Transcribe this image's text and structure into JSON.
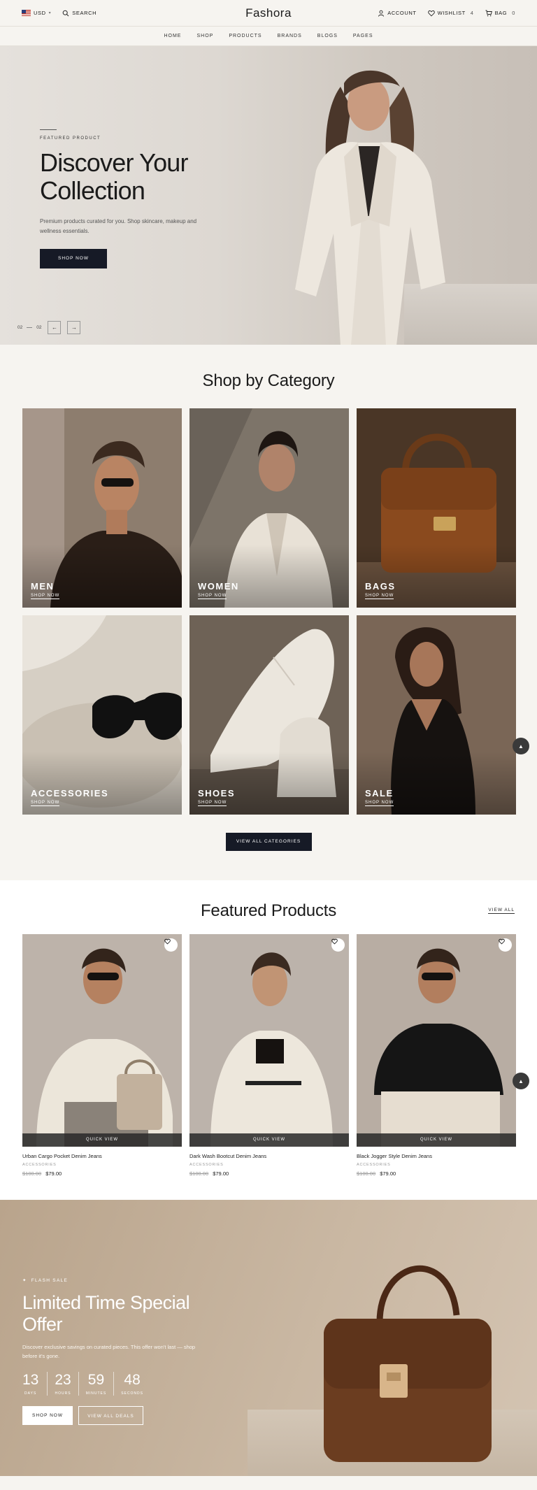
{
  "topbar": {
    "currency": "USD",
    "search_label": "SEARCH",
    "logo": "Fashora",
    "account_label": "ACCOUNT",
    "wishlist_label": "WISHLIST",
    "wishlist_count": "4",
    "bag_label": "BAG",
    "bag_count": "0"
  },
  "nav": {
    "items": [
      "HOME",
      "SHOP",
      "PRODUCTS",
      "BRANDS",
      "BLOGS",
      "PAGES"
    ]
  },
  "hero": {
    "eyebrow": "FEATURED PRODUCT",
    "title_line1": "Discover Your",
    "title_line2": "Collection",
    "subtitle": "Premium products curated for you. Shop skincare, makeup and wellness essentials.",
    "button": "SHOP NOW",
    "pager_current": "02",
    "pager_total": "02"
  },
  "categories": {
    "title": "Shop by Category",
    "items": [
      {
        "label": "MEN",
        "link": "SHOP NOW"
      },
      {
        "label": "WOMEN",
        "link": "SHOP NOW"
      },
      {
        "label": "BAGS",
        "link": "SHOP NOW"
      },
      {
        "label": "ACCESSORIES",
        "link": "SHOP NOW"
      },
      {
        "label": "SHOES",
        "link": "SHOP NOW"
      },
      {
        "label": "SALE",
        "link": "SHOP NOW"
      }
    ],
    "button": "VIEW ALL CATEGORIES"
  },
  "featured": {
    "title": "Featured Products",
    "view_all": "VIEW ALL",
    "products": [
      {
        "name": "Urban Cargo Pocket Denim Jeans",
        "category": "ACCESSORIES",
        "old_price": "$100.00",
        "price": "$79.00",
        "quick_view": "QUICK VIEW"
      },
      {
        "name": "Dark Wash Bootcut Denim Jeans",
        "category": "ACCESSORIES",
        "old_price": "$100.00",
        "price": "$79.00",
        "quick_view": "QUICK VIEW"
      },
      {
        "name": "Black Jogger Style Denim Jeans",
        "category": "ACCESSORIES",
        "old_price": "$100.00",
        "price": "$79.00",
        "quick_view": "QUICK VIEW"
      }
    ]
  },
  "sale": {
    "eyebrow": "FLASH SALE",
    "title": "Limited Time Special Offer",
    "subtitle": "Discover exclusive savings on curated pieces. This offer won't last — shop before it's gone.",
    "countdown": [
      {
        "value": "13",
        "label": "DAYS"
      },
      {
        "value": "23",
        "label": "HOURS"
      },
      {
        "value": "59",
        "label": "MINUTES"
      },
      {
        "value": "48",
        "label": "SECONDS"
      }
    ],
    "primary_button": "SHOP NOW",
    "secondary_button": "VIEW ALL DEALS"
  }
}
